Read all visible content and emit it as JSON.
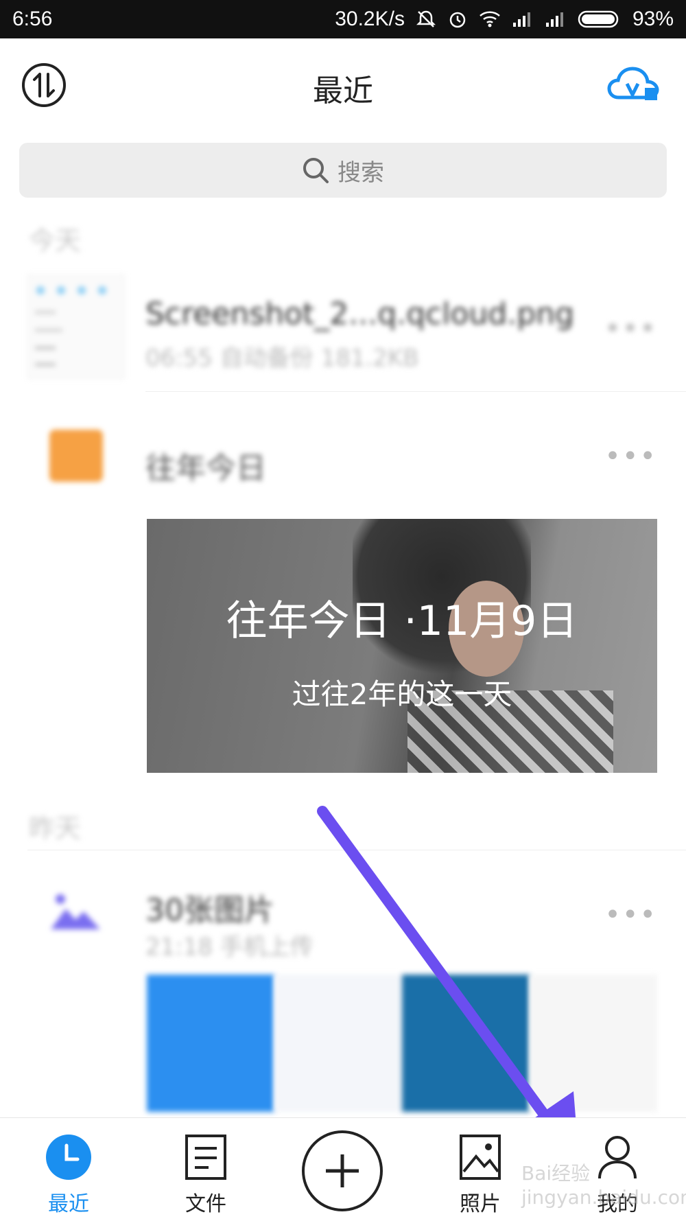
{
  "status": {
    "time": "6:56",
    "speed": "30.2K/s",
    "battery": "93%"
  },
  "header": {
    "title": "最近"
  },
  "search": {
    "placeholder": "搜索"
  },
  "sections": {
    "today": "今天",
    "yesterday": "昨天"
  },
  "items": {
    "screenshot_name": "Screenshot_2...q.qcloud.png",
    "screenshot_meta": "06:55 自动备份 181.2KB",
    "memories_title": "往年今日",
    "photos_title": "30张图片",
    "photos_meta": "21:18 手机上传"
  },
  "banner": {
    "title": "往年今日 ·11月9日",
    "subtitle": "过往2年的这一天"
  },
  "nav": {
    "recent": "最近",
    "files": "文件",
    "photos": "照片",
    "mine": "我的"
  },
  "colors": {
    "accent": "#1a8ff0",
    "arrow": "#6b4ef0",
    "calendar": "#f6a144"
  },
  "watermark": "Bai经验 jingyan.baidu.com"
}
